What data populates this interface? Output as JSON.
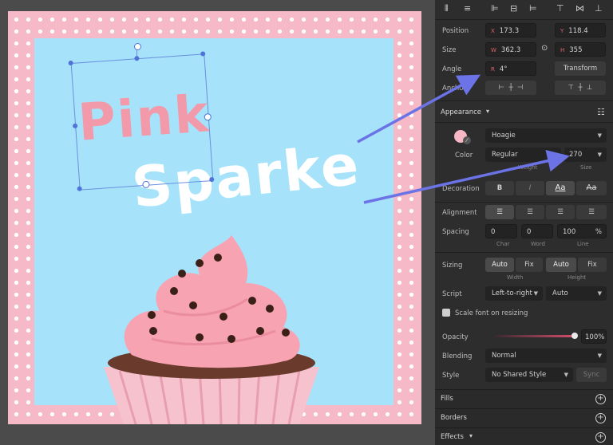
{
  "canvas": {
    "text_pink": "Pink",
    "text_sparkle": "Sparke"
  },
  "panel": {
    "position_label": "Position",
    "x_prefix": "X",
    "x_value": "173.3",
    "y_prefix": "Y",
    "y_value": "118.4",
    "size_label": "Size",
    "w_prefix": "W",
    "w_value": "362.3",
    "h_prefix": "H",
    "h_value": "355",
    "angle_label": "Angle",
    "angle_prefix": "R",
    "angle_value": "4°",
    "transform_label": "Transform",
    "anchors_label": "Anchors",
    "appearance_label": "Appearance",
    "font_family": "Hoagie",
    "color_label": "Color",
    "font_weight": "Regular",
    "font_size": "270",
    "weight_sub": "Weight",
    "size_sub": "Size",
    "decoration_label": "Decoration",
    "deco_bold": "B",
    "deco_italic": "I",
    "deco_underline": "Aa",
    "deco_strike": "Aa",
    "alignment_label": "Alignment",
    "spacing_label": "Spacing",
    "char_value": "0",
    "word_value": "0",
    "line_value": "100",
    "line_unit": "%",
    "char_sub": "Char",
    "word_sub": "Word",
    "line_sub": "Line",
    "sizing_label": "Sizing",
    "width_auto": "Auto",
    "width_fix": "Fix",
    "height_auto": "Auto",
    "height_fix": "Fix",
    "width_sub": "Width",
    "height_sub": "Height",
    "script_label": "Script",
    "script_direction": "Left-to-right",
    "script_auto": "Auto",
    "scale_font_label": "Scale font on resizing",
    "opacity_label": "Opacity",
    "opacity_value": "100%",
    "opacity_level": 1.0,
    "blending_label": "Blending",
    "blending_value": "Normal",
    "style_label": "Style",
    "style_value": "No Shared Style",
    "sync_label": "Sync",
    "fills_label": "Fills",
    "borders_label": "Borders",
    "effects_label": "Effects"
  },
  "colors": {
    "accent_arrow": "#6b73e6",
    "text_color_swatch": "#f6b8c4",
    "artboard_pink": "#f5b9c8",
    "sky_blue": "#a6e3fa"
  }
}
